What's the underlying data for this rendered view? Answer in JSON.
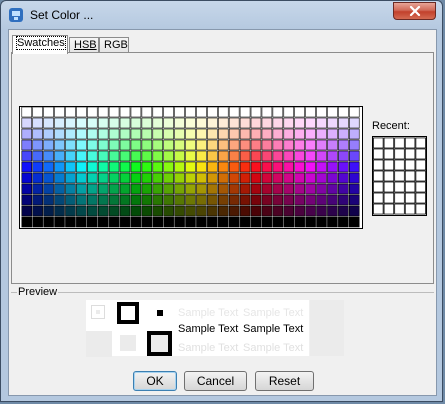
{
  "window": {
    "title": "Set Color ...",
    "close_icon": "close-icon"
  },
  "tabs": [
    {
      "label": "Swatches",
      "active": true
    },
    {
      "label": "HSB",
      "active": false
    },
    {
      "label": "RGB",
      "active": false
    }
  ],
  "swatches": {
    "recent_label": "Recent:"
  },
  "preview": {
    "label": "Preview",
    "sample_text": "Sample Text"
  },
  "buttons": {
    "ok": "OK",
    "cancel": "Cancel",
    "reset": "Reset"
  }
}
